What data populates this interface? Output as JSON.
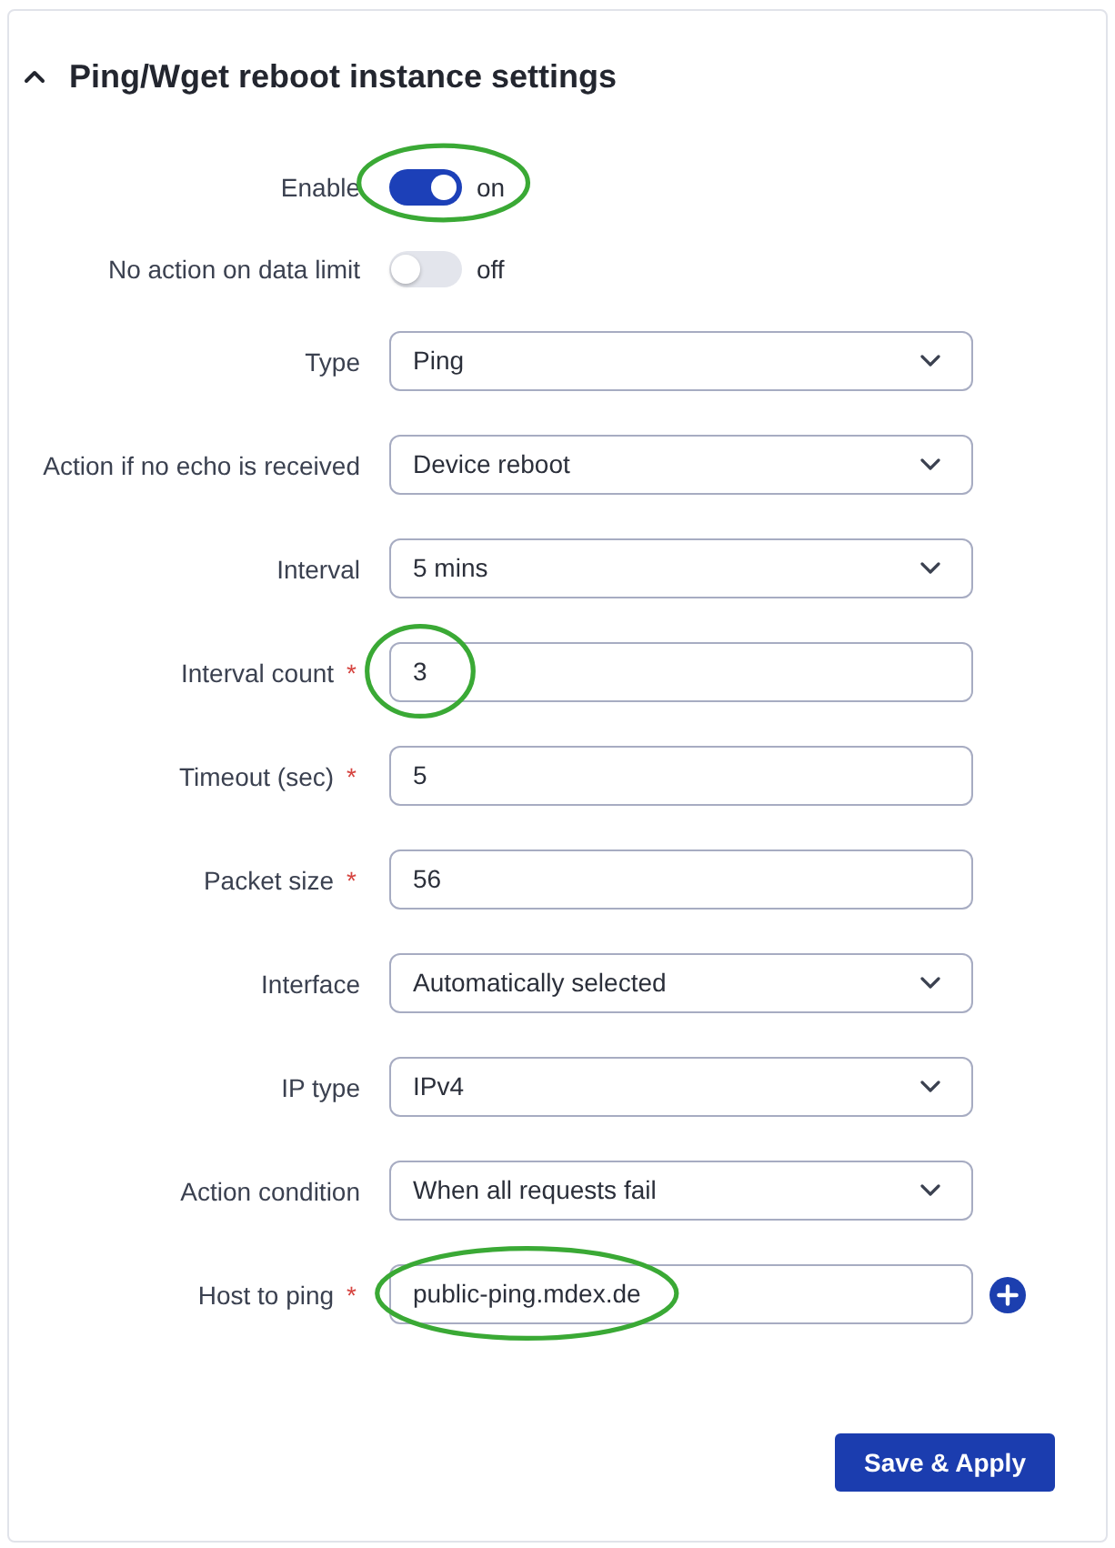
{
  "section": {
    "title": "Ping/Wget reboot instance settings",
    "expanded": true
  },
  "fields": [
    {
      "kind": "toggle",
      "label": "Enable",
      "on": true,
      "state_label": "on",
      "circled": true,
      "add_button": false
    },
    {
      "kind": "toggle",
      "label": "No action on data limit",
      "on": false,
      "state_label": "off",
      "circled": false,
      "add_button": false
    },
    {
      "kind": "select",
      "label": "Type",
      "value": "Ping",
      "circled": false,
      "add_button": false
    },
    {
      "kind": "select",
      "label": "Action if no echo is received",
      "value": "Device reboot",
      "circled": false,
      "add_button": false
    },
    {
      "kind": "select",
      "label": "Interval",
      "value": "5 mins",
      "circled": false,
      "add_button": false
    },
    {
      "kind": "input",
      "label": "Interval count",
      "required_mark": "*",
      "value": "3",
      "circled": true,
      "add_button": false
    },
    {
      "kind": "input",
      "label": "Timeout (sec)",
      "required_mark": "*",
      "value": "5",
      "circled": false,
      "add_button": false
    },
    {
      "kind": "input",
      "label": "Packet size",
      "required_mark": "*",
      "value": "56",
      "circled": false,
      "add_button": false
    },
    {
      "kind": "select",
      "label": "Interface",
      "value": "Automatically selected",
      "circled": false,
      "add_button": false
    },
    {
      "kind": "select",
      "label": "IP type",
      "value": "IPv4",
      "circled": false,
      "add_button": false
    },
    {
      "kind": "select",
      "label": "Action condition",
      "value": "When all requests fail",
      "circled": false,
      "add_button": false
    },
    {
      "kind": "input",
      "label": "Host to ping",
      "required_mark": "*",
      "value": "public-ping.mdex.de",
      "circled": true,
      "add_button": true
    }
  ],
  "buttons": [
    {
      "label": "Save & Apply"
    }
  ]
}
